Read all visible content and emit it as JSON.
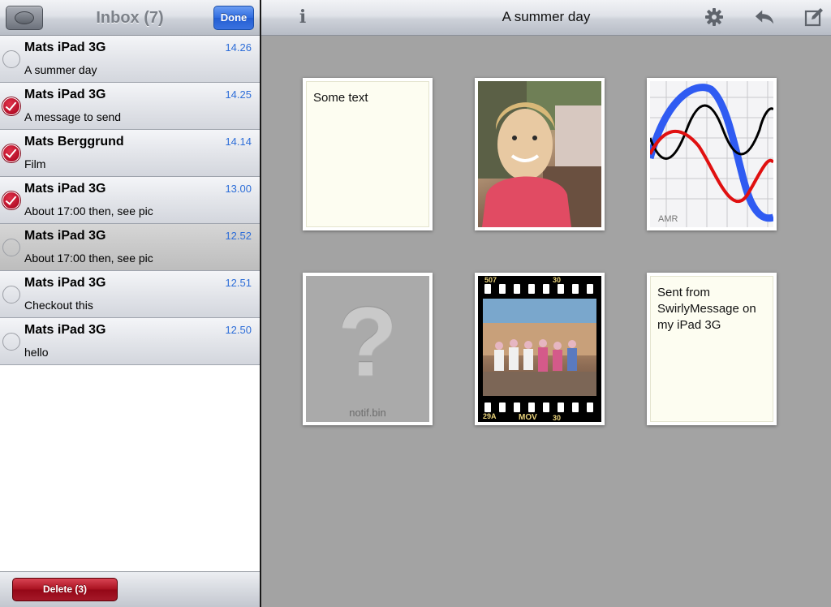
{
  "left": {
    "title": "Inbox (7)",
    "done_label": "Done",
    "delete_label": "Delete (3)",
    "messages": [
      {
        "sender": "Mats iPad 3G",
        "time": "14.26",
        "subject": "A summer day",
        "checked": false,
        "selected": false
      },
      {
        "sender": "Mats iPad 3G",
        "time": "14.25",
        "subject": "A message to send",
        "checked": true,
        "selected": false
      },
      {
        "sender": "Mats Berggrund",
        "time": "14.14",
        "subject": "Film",
        "checked": true,
        "selected": false
      },
      {
        "sender": "Mats iPad 3G",
        "time": "13.00",
        "subject": "About 17:00 then, see pic",
        "checked": true,
        "selected": false
      },
      {
        "sender": "Mats iPad 3G",
        "time": "12.52",
        "subject": "About 17:00 then, see pic",
        "checked": false,
        "selected": true
      },
      {
        "sender": "Mats iPad 3G",
        "time": "12.51",
        "subject": "Checkout this",
        "checked": false,
        "selected": false
      },
      {
        "sender": "Mats iPad 3G",
        "time": "12.50",
        "subject": "hello",
        "checked": false,
        "selected": false
      }
    ]
  },
  "right": {
    "title": "A summer day",
    "icons": [
      "info-icon",
      "gear-icon",
      "reply-icon",
      "compose-icon"
    ],
    "attachments": {
      "note1_text": "Some text",
      "amr_label": "AMR",
      "unknown_file": "notif.bin",
      "film_top_left": "507",
      "film_top_right": "30",
      "film_bottom_left": "29A",
      "film_bottom_mid": "MOV",
      "film_bottom_right": "30",
      "note2_text": "Sent from SwirlyMessage on my iPad 3G"
    }
  },
  "colors": {
    "accent_blue": "#2e6ed8",
    "check_red": "#c4132b",
    "content_bg": "#a3a3a3"
  }
}
